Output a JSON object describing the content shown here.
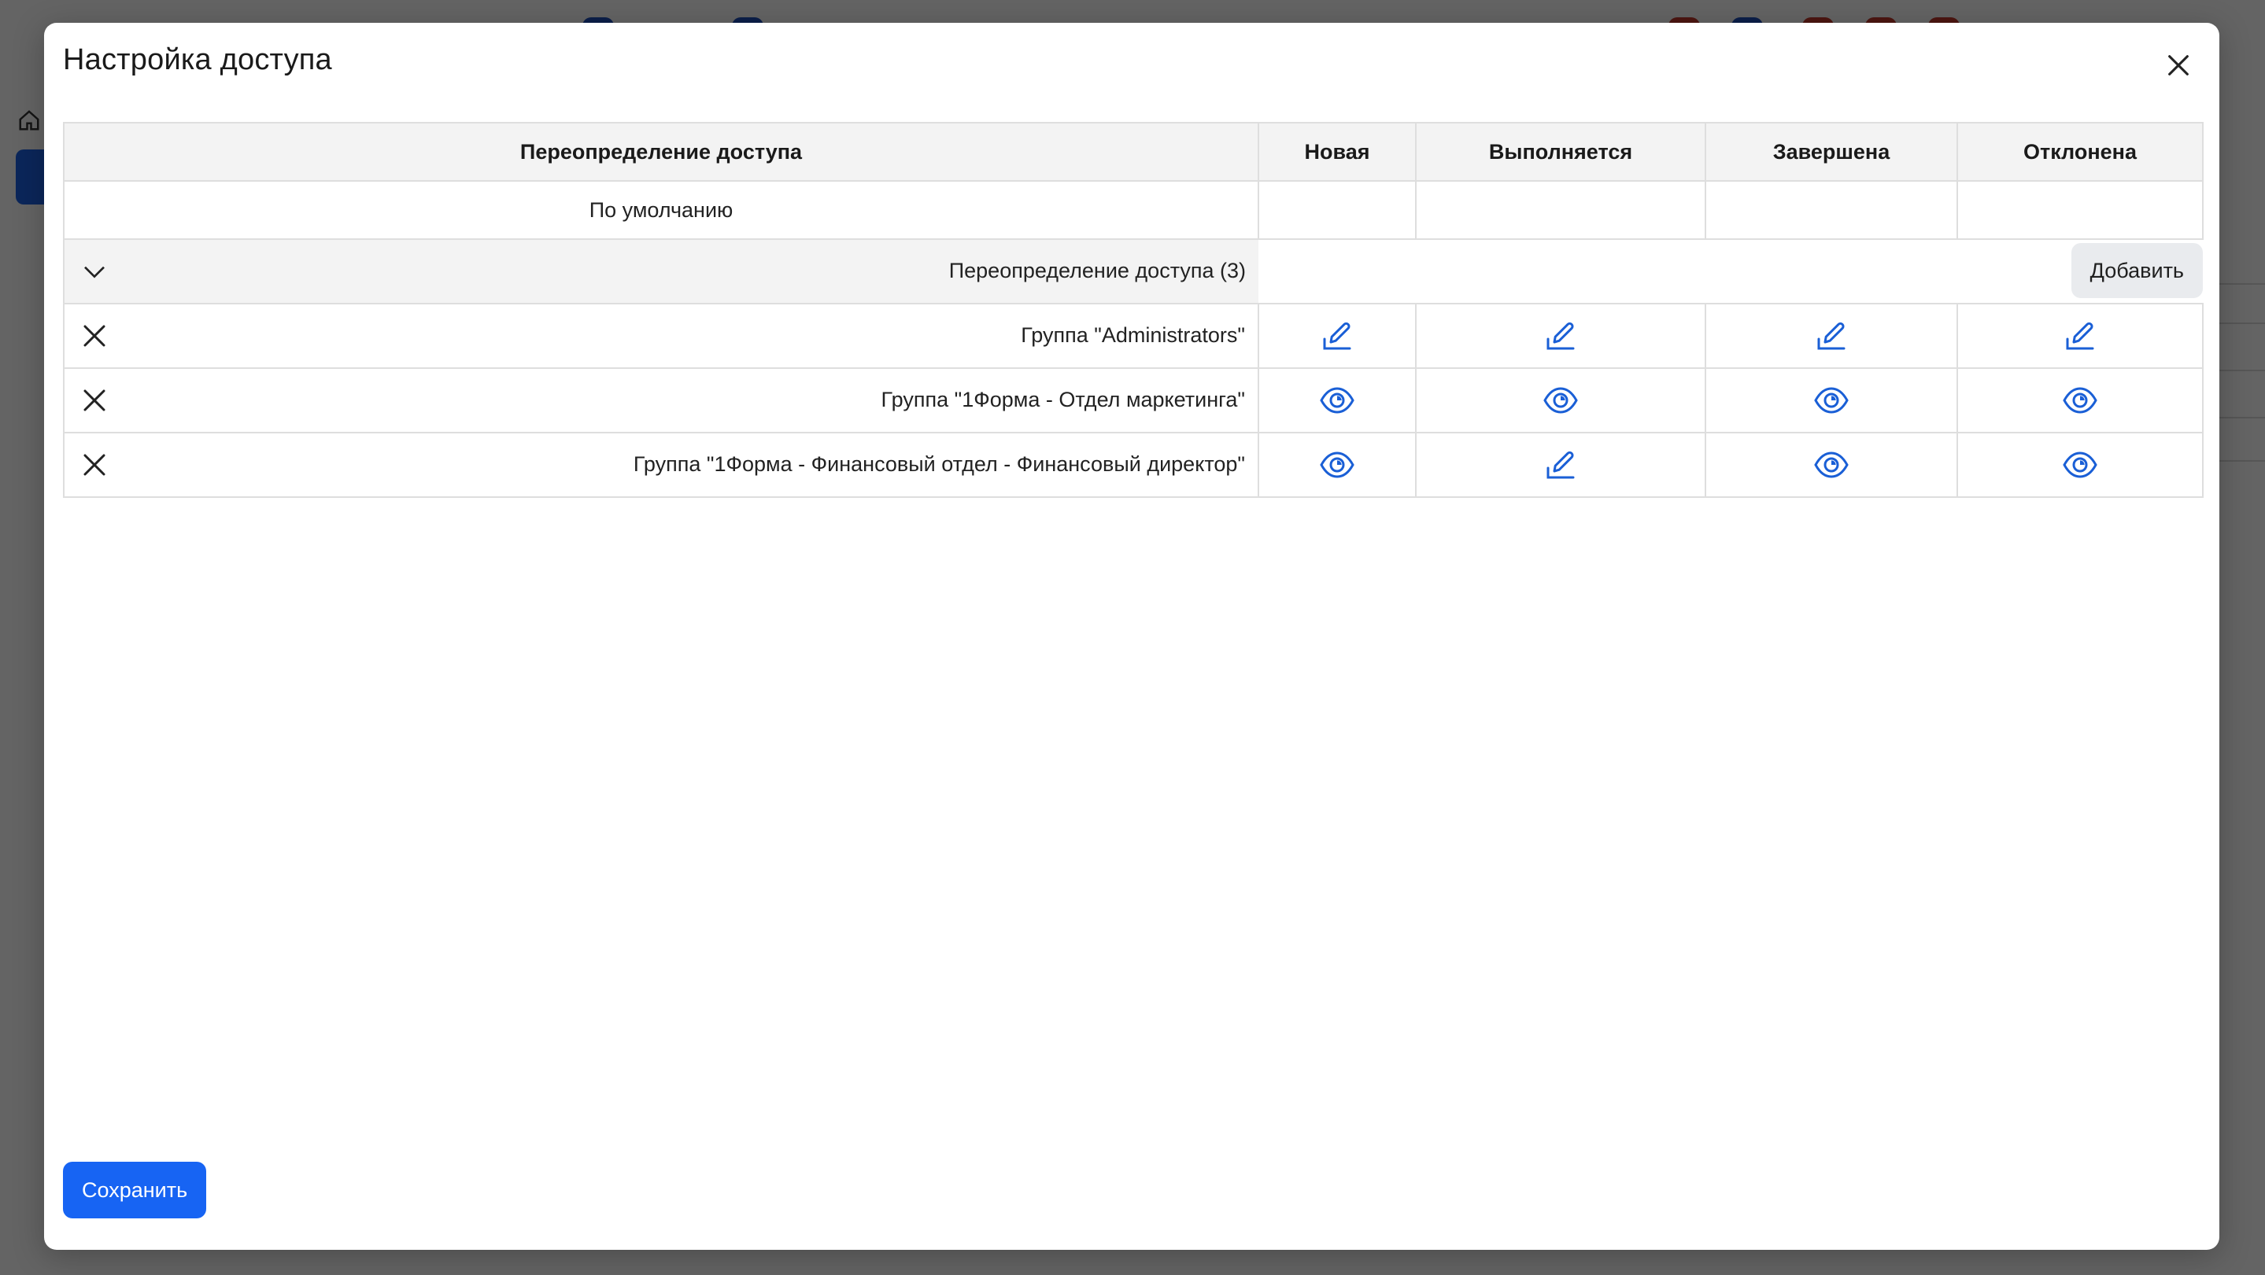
{
  "modal": {
    "title": "Настройка доступа",
    "close_icon": "close-icon",
    "save_label": "Сохранить"
  },
  "table": {
    "headers": [
      "Переопределение доступа",
      "Новая",
      "Выполняется",
      "Завершена",
      "Отклонена"
    ],
    "default_row": {
      "label": "По умолчанию",
      "values": [
        "",
        "",
        "",
        ""
      ]
    },
    "override_group": {
      "label": "Переопределение доступа (3)",
      "toggle_icon": "chevron-down-icon",
      "add_label": "Добавить"
    },
    "rows": [
      {
        "label": "Группа \"Administrators\"",
        "perms": [
          "edit",
          "edit",
          "edit",
          "edit"
        ]
      },
      {
        "label": "Группа \"1Форма - Отдел маркетинга\"",
        "perms": [
          "view",
          "view",
          "view",
          "view"
        ]
      },
      {
        "label": "Группа \"1Форма - Финансовый отдел - Финансовый директор\"",
        "perms": [
          "view",
          "edit",
          "view",
          "view"
        ]
      }
    ]
  },
  "icons": {
    "edit": "pencil-edit-icon",
    "view": "eye-view-icon",
    "remove": "close-icon"
  },
  "colors": {
    "accent": "#1764f3",
    "icon_blue": "#1a5fd6",
    "header_bg": "#f3f3f3",
    "border": "#dedede"
  }
}
